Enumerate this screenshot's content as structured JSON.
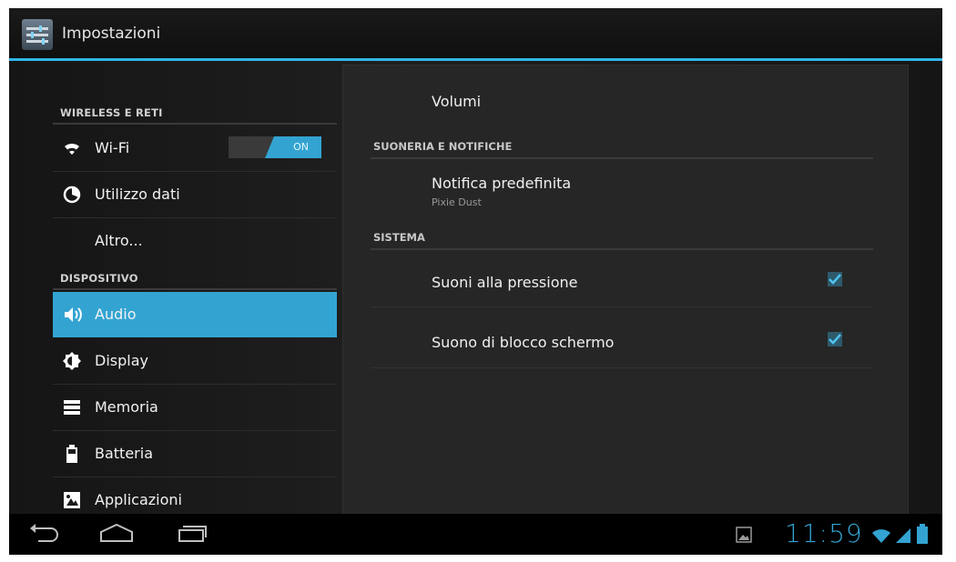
{
  "app": {
    "title": "Impostazioni"
  },
  "sidebar": {
    "sections": [
      {
        "label": "WIRELESS E RETI"
      },
      {
        "label": "DISPOSITIVO"
      }
    ],
    "items": [
      {
        "label": "Wi-Fi",
        "icon": "wifi-icon",
        "toggle": "ON"
      },
      {
        "label": "Utilizzo dati",
        "icon": "data-usage-icon"
      },
      {
        "label": "Altro..."
      },
      {
        "label": "Audio",
        "icon": "speaker-icon",
        "selected": true
      },
      {
        "label": "Display",
        "icon": "brightness-icon"
      },
      {
        "label": "Memoria",
        "icon": "storage-icon"
      },
      {
        "label": "Batteria",
        "icon": "battery-icon"
      },
      {
        "label": "Applicazioni",
        "icon": "apps-icon"
      }
    ]
  },
  "detail": {
    "volumi": "Volumi",
    "sections": [
      {
        "label": "SUONERIA E NOTIFICHE"
      },
      {
        "label": "SISTEMA"
      }
    ],
    "notification": {
      "title": "Notifica predefinita",
      "subtitle": "Pixie Dust"
    },
    "checks": [
      {
        "label": "Suoni alla pressione",
        "checked": true
      },
      {
        "label": "Suono di blocco schermo",
        "checked": true
      }
    ]
  },
  "statusbar": {
    "time": "11:59"
  },
  "colors": {
    "accent": "#33a4d2",
    "background": "#1a1a1a"
  }
}
